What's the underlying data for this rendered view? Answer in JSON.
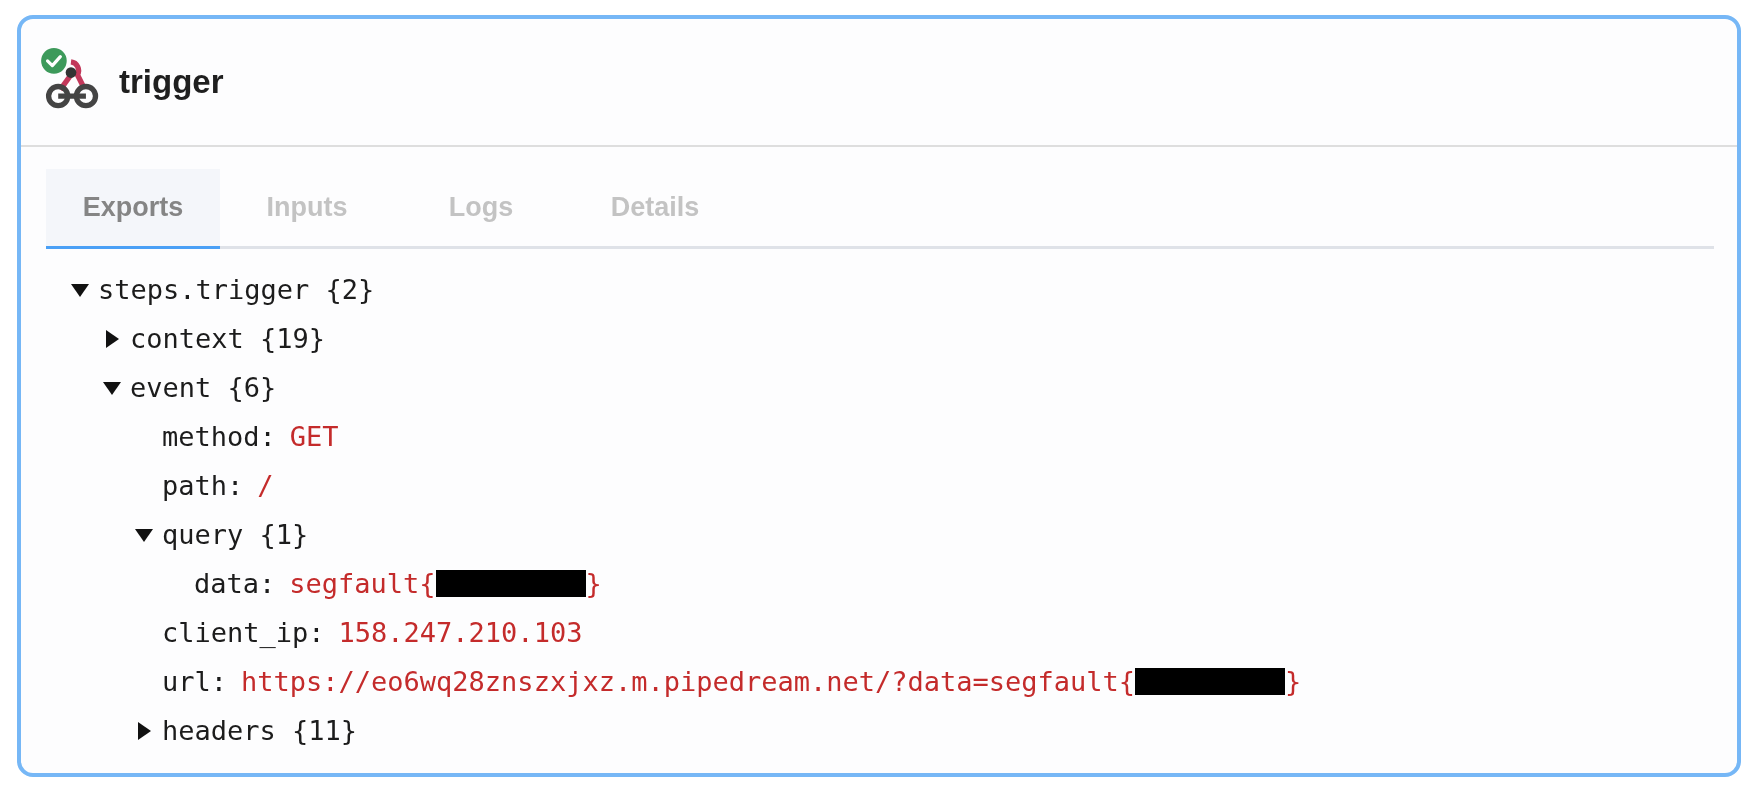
{
  "step": {
    "title": "trigger",
    "completed": true
  },
  "tabs": [
    {
      "label": "Exports",
      "selected": true
    },
    {
      "label": "Inputs",
      "selected": false
    },
    {
      "label": "Logs",
      "selected": false
    },
    {
      "label": "Details",
      "selected": false
    }
  ],
  "tree": [
    {
      "key": "steps.trigger",
      "count": "{2}",
      "expanded": true,
      "children": [
        {
          "key": "context",
          "count": "{19}",
          "expanded": false
        },
        {
          "key": "event",
          "count": "{6}",
          "expanded": true,
          "children": [
            {
              "key": "method:",
              "value": "GET"
            },
            {
              "key": "path:",
              "value": "/"
            },
            {
              "key": "query",
              "count": "{1}",
              "expanded": true,
              "children": [
                {
                  "key": "data:",
                  "value": "segfault{",
                  "redacted": true,
                  "value_end": "}"
                }
              ]
            },
            {
              "key": "client_ip:",
              "value": "158.247.210.103"
            },
            {
              "key": "url:",
              "value": "https://eo6wq28znszxjxz.m.pipedream.net/?data=segfault{",
              "redacted": true,
              "value_end": "}"
            },
            {
              "key": "headers",
              "count": "{11}",
              "expanded": false
            }
          ]
        }
      ]
    }
  ]
}
